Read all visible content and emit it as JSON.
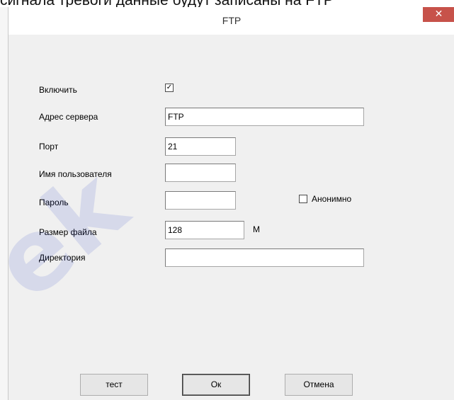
{
  "background": {
    "text": "сигнала тревоги данные будут записаны на FTP"
  },
  "watermark": {
    "text": "ek"
  },
  "window": {
    "title": "FTP",
    "close_glyph": "✕"
  },
  "form": {
    "enable": {
      "label": "Включить",
      "checked": true,
      "mark": "✓"
    },
    "server": {
      "label": "Адрес сервера",
      "value": "FTP"
    },
    "port": {
      "label": "Порт",
      "value": "21"
    },
    "username": {
      "label": "Имя пользователя",
      "value": ""
    },
    "password": {
      "label": "Пароль",
      "value": ""
    },
    "anonymous": {
      "label": "Анонимно",
      "checked": false
    },
    "filesize": {
      "label": "Размер файла",
      "value": "128",
      "unit": "М"
    },
    "directory": {
      "label": "Директория",
      "value": ""
    }
  },
  "buttons": {
    "test": "тест",
    "ok": "Ок",
    "cancel": "Отмена"
  },
  "colors": {
    "close_button": "#c7524a",
    "dialog_bg": "#f0f0f0"
  }
}
